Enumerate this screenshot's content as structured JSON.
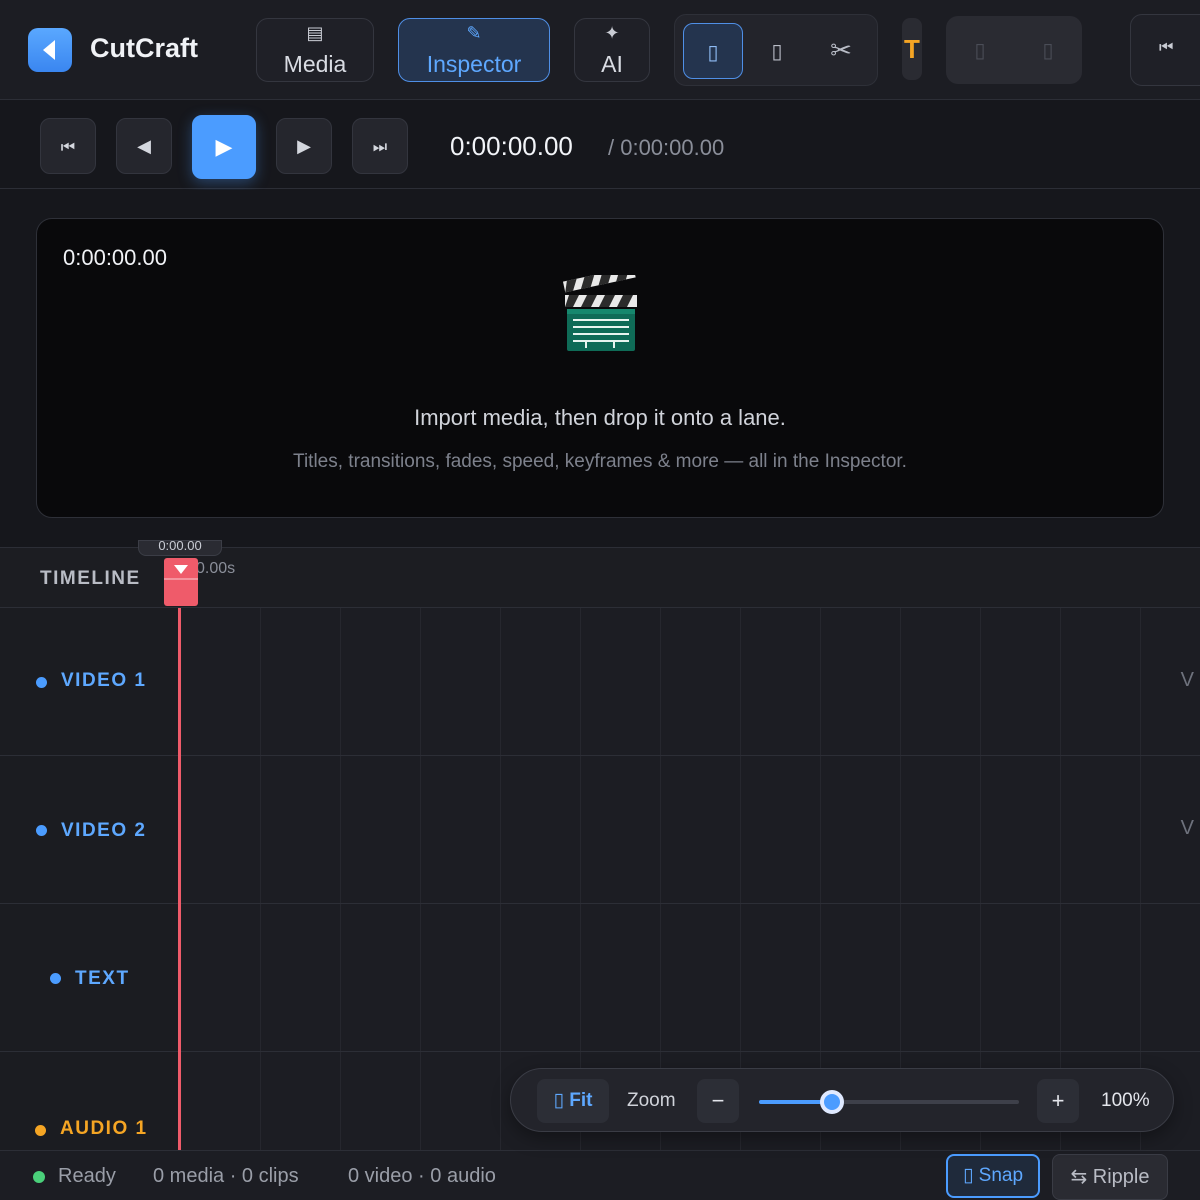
{
  "app": {
    "title": "CutCraft"
  },
  "tabs": [
    {
      "icon": "list-icon",
      "glyph": "▤",
      "label": "Media"
    },
    {
      "icon": "pencil-icon",
      "glyph": "✎",
      "label": "Inspector",
      "active": true
    },
    {
      "icon": "sparkle-icon",
      "glyph": "✦",
      "label": "AI"
    }
  ],
  "tools": {
    "select_glyph": "▯",
    "blade_glyph": "▯",
    "cut_glyph": "✂",
    "text_glyph": "T",
    "undo_glyph": "▯",
    "redo_glyph": "▯",
    "skip_glyph": "⏮"
  },
  "transport": {
    "start_glyph": "⏮",
    "back_glyph": "◀",
    "play_glyph": "▶",
    "forward_glyph": "▶",
    "end_glyph": "⏭",
    "current_time": "0:00:00.00",
    "total_time": "/ 0:00:00.00"
  },
  "preview": {
    "time": "0:00:00.00",
    "empty_title": "Import media, then drop it onto a lane.",
    "empty_subtitle": "Titles, transitions, fades, speed, keyframes & more — all in the Inspector."
  },
  "timeline": {
    "label": "TIMELINE",
    "ruler_tick": "0.00s",
    "playhead_time": "0:00.00",
    "lanes": [
      {
        "name": "VIDEO 1",
        "tag": "V",
        "color": "#4b9cff"
      },
      {
        "name": "VIDEO 2",
        "tag": "V",
        "color": "#4b9cff"
      },
      {
        "name": "TEXT",
        "tag": "",
        "color": "#4b9cff"
      },
      {
        "name": "AUDIO 1",
        "tag": "",
        "color": "#f5a524"
      }
    ]
  },
  "zoom": {
    "fit_label": "▯ Fit",
    "label": "Zoom",
    "minus": "−",
    "plus": "+",
    "value": "100%",
    "slider_fraction": 0.28
  },
  "status": {
    "ready": "Ready",
    "counts": "0 media · 0 clips",
    "tracks": "0 video · 0 audio",
    "snap_label": "▯ Snap",
    "ripple_label": "⇆ Ripple"
  }
}
